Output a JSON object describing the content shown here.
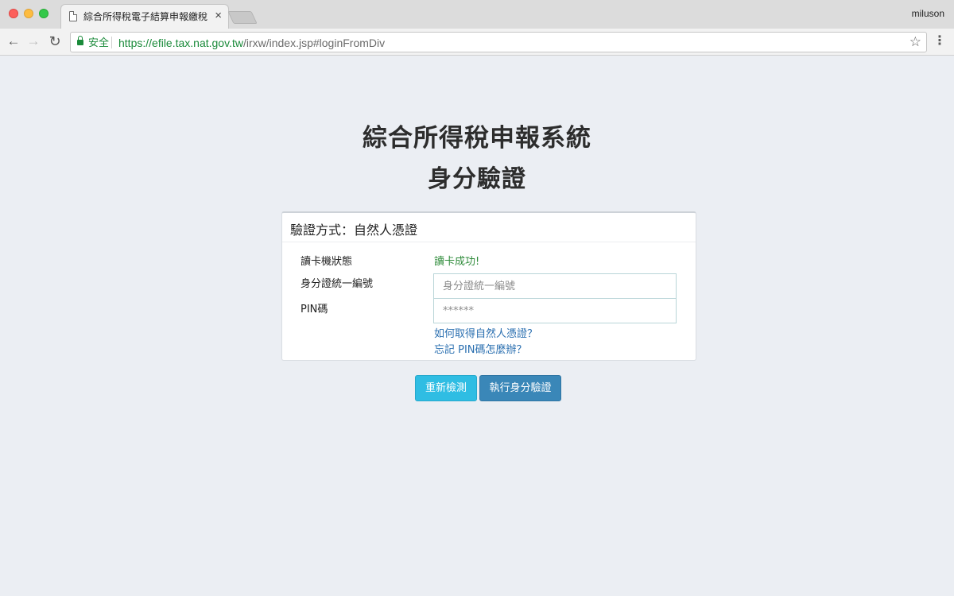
{
  "browser": {
    "tab": {
      "title": "綜合所得稅電子結算申報繳稅系統",
      "close_glyph": "×"
    },
    "profile_name": "miluson",
    "toolbar": {
      "back_glyph": "←",
      "forward_glyph": "→",
      "reload_glyph": "↻",
      "secure_label": "安全",
      "url_scheme": "https://",
      "url_host": "efile.tax.nat.gov.tw",
      "url_path": "/irxw/index.jsp#loginFromDiv",
      "star_glyph": "☆",
      "menu_glyph": "⋮"
    }
  },
  "page": {
    "title": "綜合所得稅申報系統",
    "subtitle": "身分驗證",
    "panel": {
      "heading": "驗證方式：自然人憑證",
      "card_reader_label": "讀卡機狀態",
      "card_reader_status": "讀卡成功!",
      "id_label": "身分證統一編號",
      "id_placeholder": "身分證統一編號",
      "id_value": "",
      "pin_label": "PIN碼",
      "pin_placeholder": "******",
      "pin_value": "",
      "link_get_cert": "如何取得自然人憑證？",
      "link_forgot_pin": "忘記 PIN碼怎麼辦？"
    },
    "buttons": {
      "recheck": "重新檢測",
      "verify": "執行身分驗證"
    }
  },
  "colors": {
    "page_background": "#ebeef3",
    "secure_green": "#1a8a3a",
    "status_green": "#2e8b3a",
    "link_blue": "#2a6fb0",
    "recheck_button": "#2fbde3",
    "verify_button": "#3a87b8"
  },
  "icons": {
    "tab_icon": "page-icon",
    "secure_icon": "lock-icon",
    "bookmark_icon": "star-icon",
    "menu_icon": "kebab-menu-icon"
  }
}
